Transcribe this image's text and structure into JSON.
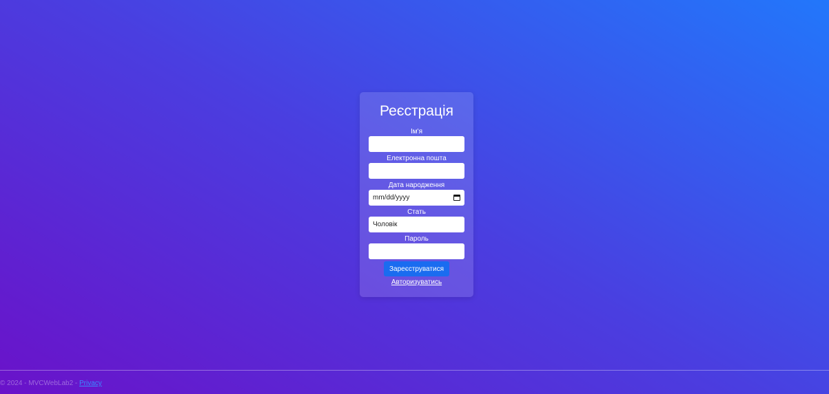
{
  "form": {
    "title": "Реєстрація",
    "name_label": "Ім'я",
    "name_value": "",
    "email_label": "Електронна пошта",
    "email_value": "",
    "birthdate_label": "Дата народження",
    "birthdate_placeholder": "mm/dd/yyyy",
    "gender_label": "Стать",
    "gender_value": "Чоловік",
    "password_label": "Пароль",
    "password_value": "",
    "submit_label": "Зареєструватися",
    "login_link": "Авторизуватись"
  },
  "footer": {
    "text": "© 2024 - MVCWebLab2 - ",
    "privacy_link": "Privacy"
  },
  "icons": {
    "calendar": "calendar-icon"
  },
  "colors": {
    "button": "#1a6cf0",
    "gradient_start": "#6a12c9",
    "gradient_end": "#2277fb"
  }
}
